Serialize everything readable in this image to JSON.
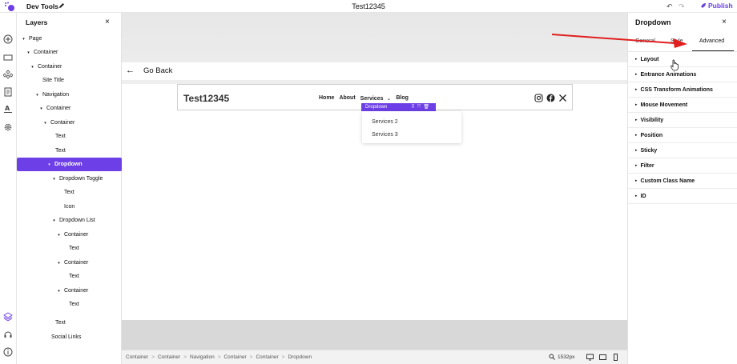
{
  "topbar": {
    "app_title": "Dev Tools",
    "doc_title": "Test12345",
    "undo_icon": "↶",
    "redo_icon": "↷",
    "publish_label": "Publish"
  },
  "layers": {
    "title": "Layers",
    "close": "×",
    "tree": [
      {
        "label": "Page",
        "caret": "▾"
      },
      {
        "label": "Container",
        "caret": "▾"
      },
      {
        "label": "Container",
        "caret": "▾"
      },
      {
        "label": "Site Title",
        "caret": ""
      },
      {
        "label": "Navigation",
        "caret": "▾"
      },
      {
        "label": "Container",
        "caret": "▾"
      },
      {
        "label": "Container",
        "caret": "▾"
      },
      {
        "label": "Text",
        "caret": ""
      },
      {
        "label": "Text",
        "caret": ""
      },
      {
        "label": "Dropdown",
        "caret": "▾"
      },
      {
        "label": "Dropdown Toggle",
        "caret": "▾"
      },
      {
        "label": "Text",
        "caret": ""
      },
      {
        "label": "Icon",
        "caret": ""
      },
      {
        "label": "Dropdown List",
        "caret": "▾"
      },
      {
        "label": "Container",
        "caret": "▾"
      },
      {
        "label": "Text",
        "caret": ""
      },
      {
        "label": "Container",
        "caret": "▾"
      },
      {
        "label": "Text",
        "caret": ""
      },
      {
        "label": "Container",
        "caret": "▾"
      },
      {
        "label": "Text",
        "caret": ""
      },
      {
        "label": "Text",
        "caret": ""
      },
      {
        "label": "Social Links",
        "caret": ""
      }
    ]
  },
  "canvas": {
    "back_arrow": "←",
    "back_label": "Go Back",
    "site_title": "Test12345",
    "nav": [
      "Home",
      "About",
      "Services",
      "Blog"
    ],
    "nav_chevron": "⌄",
    "selection_label": "Dropdown",
    "selection_tools": "⠿⤧🗑",
    "dropdown_items": [
      "Services 2",
      "Services 3"
    ],
    "breadcrumb": [
      "Container",
      "Container",
      "Navigation",
      "Container",
      "Container",
      "Dropdown"
    ],
    "breadcrumb_sep": ">",
    "zoom": "1532px"
  },
  "settings": {
    "title": "Dropdown",
    "close": "×",
    "tabs": [
      "General",
      "Style",
      "Advanced"
    ],
    "sections": [
      "Layout",
      "Entrance Animations",
      "CSS Transform Animations",
      "Mouse Movement",
      "Visibility",
      "Position",
      "Sticky",
      "Filter",
      "Custom Class Name",
      "ID"
    ],
    "section_caret": "▸"
  },
  "colors": {
    "accent": "#6d3fe6",
    "annotation_arrow": "#e02020"
  }
}
